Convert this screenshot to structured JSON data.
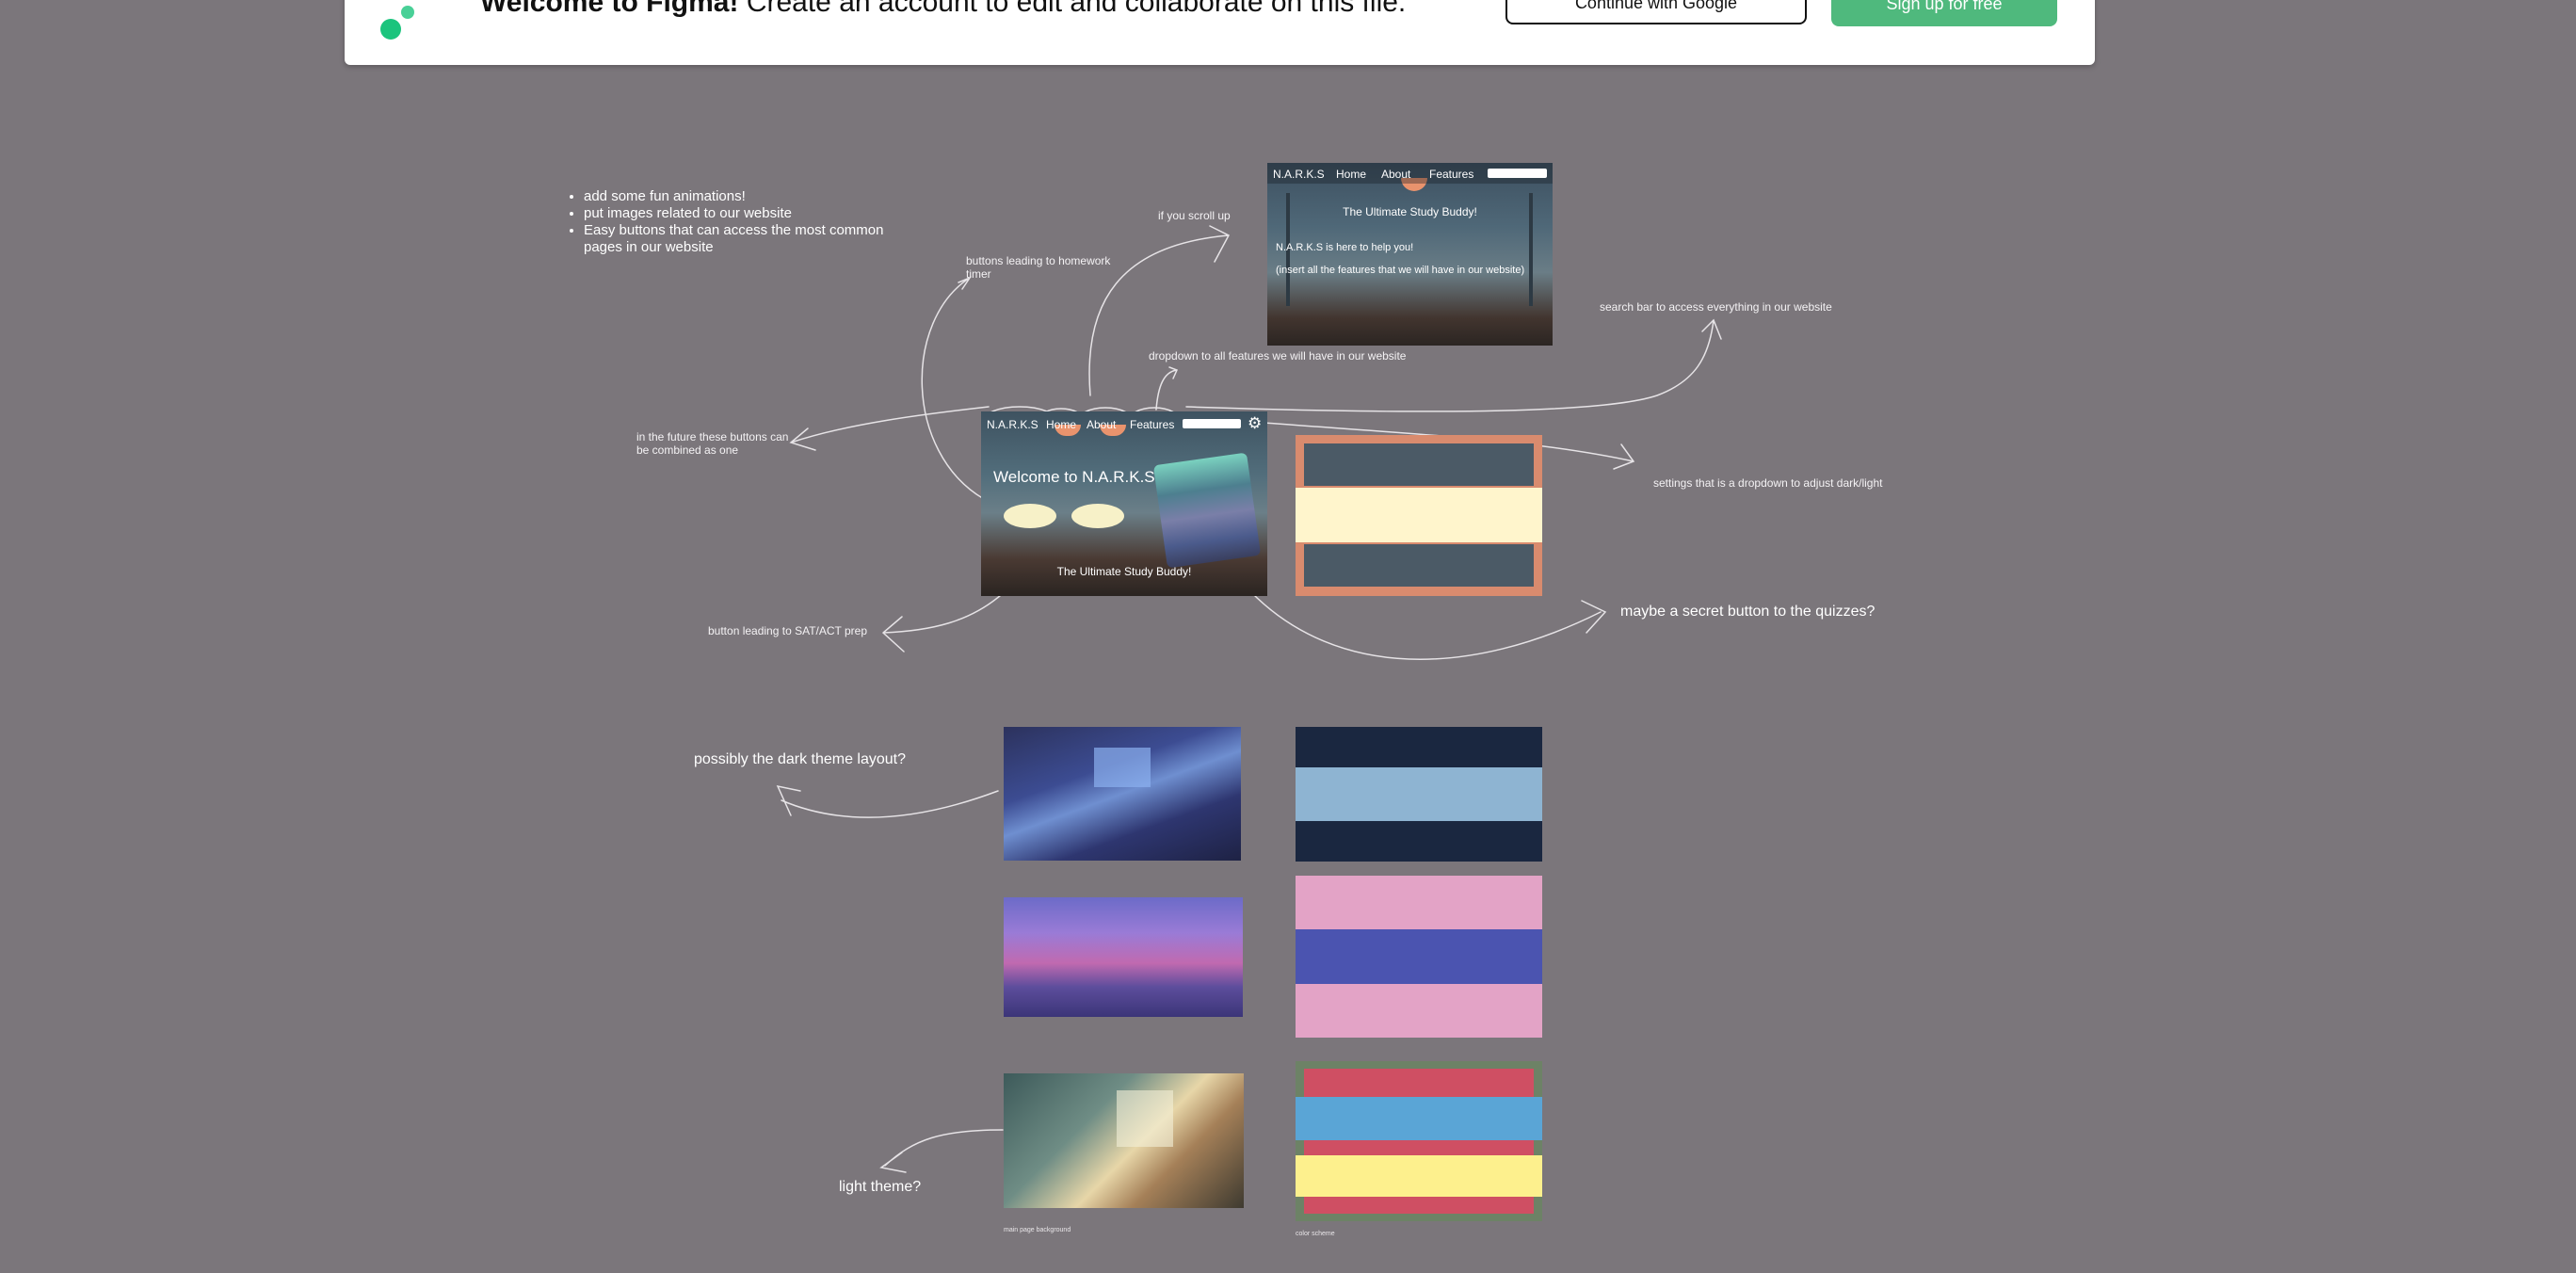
{
  "banner": {
    "message_bold": "Welcome to Figma!",
    "message_rest": " Create an account to edit and collaborate on this file.",
    "secondary_button": "Continue with Google",
    "primary_button": "Sign up for free",
    "brand_color": "#1bc47d"
  },
  "notes": {
    "bullets": [
      "add some fun animations!",
      "put images related to our website",
      "Easy buttons that can access the most common pages in our website"
    ],
    "buttons_homework": "buttons leading to homework timer",
    "if_scroll_up": "if you scroll up",
    "dropdown_features": "dropdown to all features we will have in our website",
    "search_bar": "search bar to access everything in our website",
    "combined_buttons": "in the future these buttons can be combined as one",
    "settings_dropdown": "settings that is a dropdown to adjust dark/light",
    "sat_act": "button leading to SAT/ACT prep",
    "secret_button": "maybe a secret button to the quizzes?",
    "dark_theme": "possibly the dark theme layout?",
    "light_theme": "light theme?",
    "main_bg_caption": "main page background",
    "color_caption": "color scheme"
  },
  "mock_top": {
    "brand": "N.A.R.K.S",
    "nav": [
      "Home",
      "About",
      "Features"
    ],
    "headline": "The Ultimate Study Buddy!",
    "line1": "N.A.R.K.S is here to help you!",
    "line2": "(insert all the features that we will have in our website)"
  },
  "mock_main": {
    "brand": "N.A.R.K.S",
    "nav": [
      "Home",
      "About",
      "Features"
    ],
    "welcome": "Welcome to N.A.R.K.S",
    "tagline": "The Ultimate Study Buddy!"
  },
  "palettes": [
    {
      "frame": "#d98b6e",
      "bands": [
        "#4b5a66",
        "#fff5cc",
        "#4b5a66"
      ]
    },
    {
      "bands": [
        "#1a2740",
        "#8eb4d2",
        "#1a2740"
      ]
    },
    {
      "bands": [
        "#e3a3c6",
        "#4b54b0",
        "#e3a3c6"
      ]
    },
    {
      "frame": "#6d8266",
      "bands": [
        "#cf4f63",
        "#5aa5d6",
        "#cf4f63",
        "#fdf08d",
        "#cf4f63"
      ]
    }
  ]
}
